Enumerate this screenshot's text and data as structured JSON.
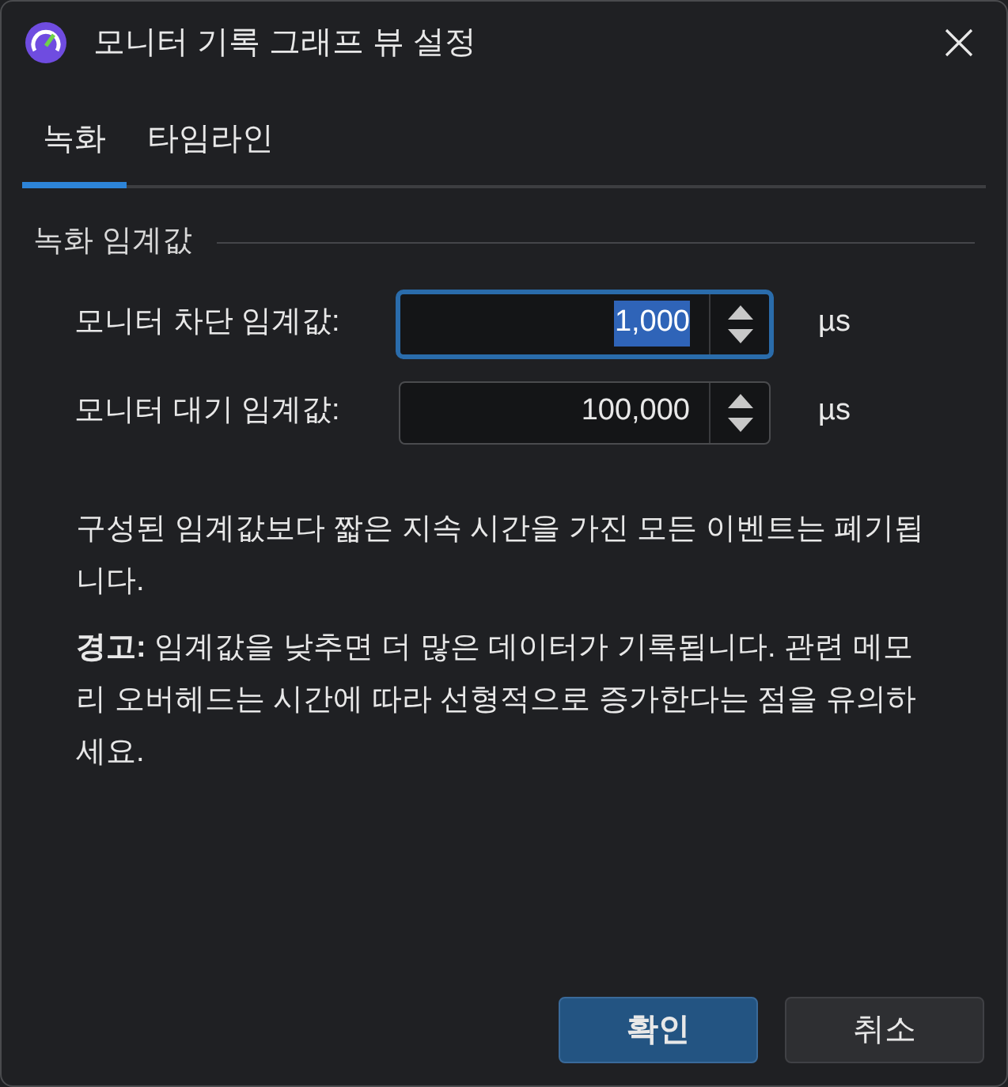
{
  "window": {
    "title": "모니터 기록 그래프 뷰 설정"
  },
  "tabs": [
    {
      "label": "녹화",
      "selected": true
    },
    {
      "label": "타임라인",
      "selected": false
    }
  ],
  "group": {
    "title": "녹화 임계값"
  },
  "fields": [
    {
      "label": "모니터 차단 임계값:",
      "value": "1,000",
      "unit": "µs",
      "focused": true
    },
    {
      "label": "모니터 대기 임계값:",
      "value": "100,000",
      "unit": "µs",
      "focused": false
    }
  ],
  "paragraphs": [
    "구성된 임계값보다 짧은 지속 시간을 가진 모든 이벤트는 폐기됩니다.",
    "**경고:** 임계값을 낮추면 더 많은 데이터가 기록됩니다. 관련 메모리 오버헤드는 시간에 따라 선형적으로 증가한다는 점을 유의하세요."
  ],
  "buttons": [
    {
      "label": "확인",
      "default": true
    },
    {
      "label": "취소",
      "default": false
    }
  ]
}
